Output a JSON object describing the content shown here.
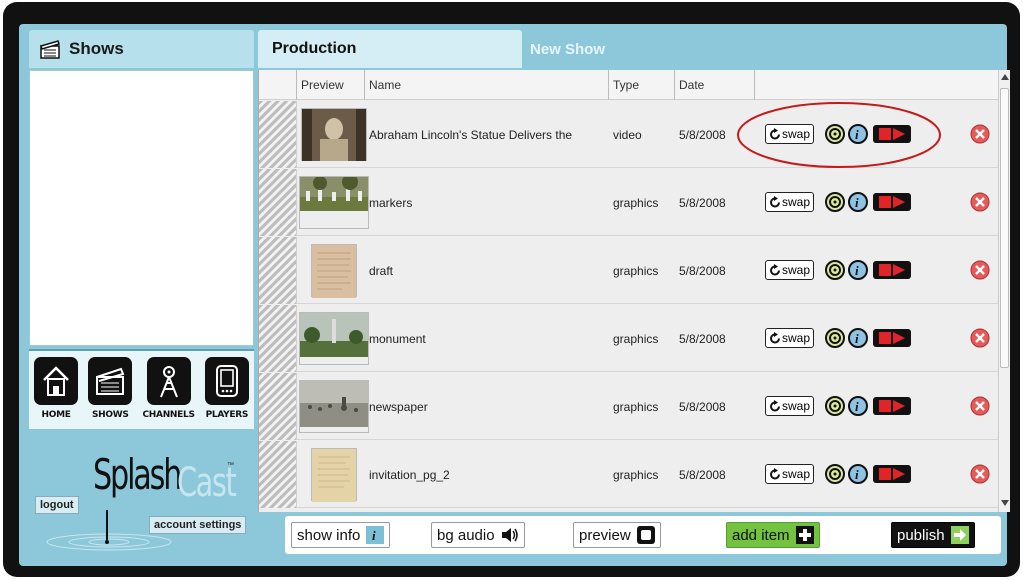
{
  "left_panel": {
    "shows_title": "Shows",
    "nav": [
      {
        "label": "HOME",
        "icon": "home-icon"
      },
      {
        "label": "SHOWS",
        "icon": "clapperboard-icon"
      },
      {
        "label": "CHANNELS",
        "icon": "tower-icon"
      },
      {
        "label": "PLAYERS",
        "icon": "player-device-icon"
      }
    ],
    "logo_splash": "Splash",
    "logo_cast": "Cast",
    "logo_tm": "™",
    "logout_label": "logout",
    "account_settings_label": "account settings"
  },
  "tabs": {
    "production": "Production",
    "new_show": "New Show"
  },
  "table": {
    "columns": [
      "Preview",
      "Name",
      "Type",
      "Date"
    ],
    "swap_label": "swap",
    "rows": [
      {
        "name": "Abraham Lincoln's Statue Delivers the",
        "type": "video",
        "date": "5/8/2008",
        "thumb": "statue"
      },
      {
        "name": "markers",
        "type": "graphics",
        "date": "5/8/2008",
        "thumb": "markers"
      },
      {
        "name": "draft",
        "type": "graphics",
        "date": "5/8/2008",
        "thumb": "draft"
      },
      {
        "name": "monument",
        "type": "graphics",
        "date": "5/8/2008",
        "thumb": "monument"
      },
      {
        "name": "newspaper",
        "type": "graphics",
        "date": "5/8/2008",
        "thumb": "newspaper"
      },
      {
        "name": "invitation_pg_2",
        "type": "graphics",
        "date": "5/8/2008",
        "thumb": "invitation"
      }
    ]
  },
  "toolbar": {
    "show_info": "show info",
    "bg_audio": "bg audio",
    "preview": "preview",
    "add_item": "add item",
    "publish": "publish"
  },
  "colors": {
    "app_bg": "#8cc8d9",
    "tab_active": "#d5eef5",
    "add_green": "#73c341",
    "annotation_red": "#c41a1a"
  }
}
